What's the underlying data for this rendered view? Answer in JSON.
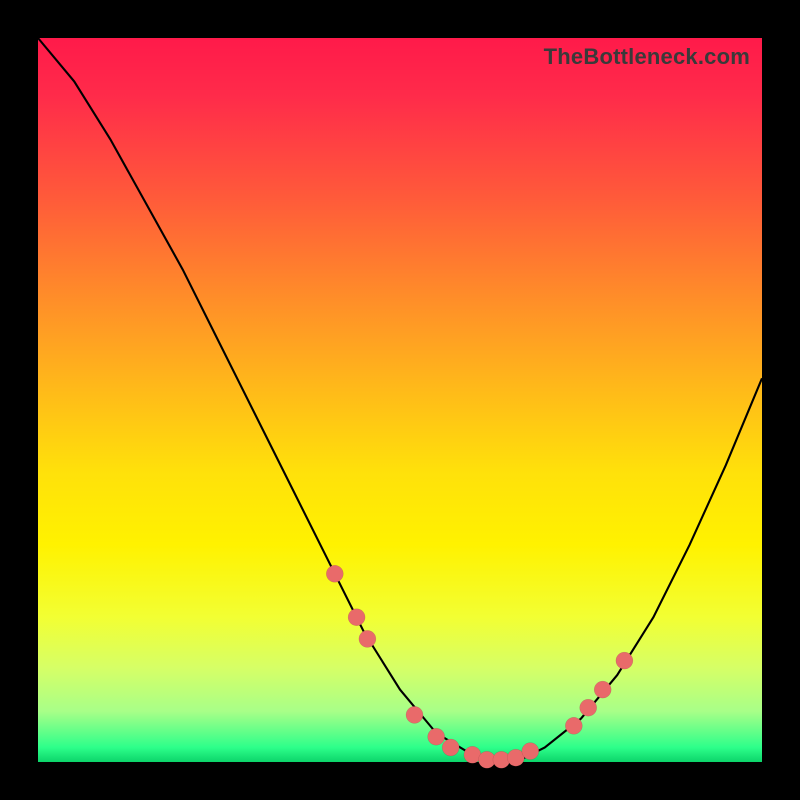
{
  "watermark": "TheBottleneck.com",
  "colors": {
    "frame": "#000000",
    "dot": "#e96a6a",
    "curve": "#000000"
  },
  "chart_data": {
    "type": "line",
    "title": "",
    "xlabel": "",
    "ylabel": "",
    "xlim": [
      0,
      100
    ],
    "ylim": [
      0,
      100
    ],
    "series": [
      {
        "name": "bottleneck-curve",
        "x": [
          0,
          5,
          10,
          15,
          20,
          25,
          30,
          35,
          40,
          45,
          50,
          55,
          60,
          62,
          64,
          67,
          70,
          75,
          80,
          85,
          90,
          95,
          100
        ],
        "y": [
          100,
          94,
          86,
          77,
          68,
          58,
          48,
          38,
          28,
          18,
          10,
          4,
          1,
          0,
          0,
          0.5,
          2,
          6,
          12,
          20,
          30,
          41,
          53
        ]
      }
    ],
    "markers": {
      "name": "highlighted-range-dots",
      "x": [
        41,
        44,
        45.5,
        52,
        55,
        57,
        60,
        62,
        64,
        66,
        68,
        74,
        76,
        78,
        81
      ],
      "y": [
        26,
        20,
        17,
        6.5,
        3.5,
        2,
        1,
        0.3,
        0.3,
        0.6,
        1.5,
        5,
        7.5,
        10,
        14
      ]
    },
    "gradient_stops": [
      {
        "pos": 0,
        "color": "#ff1a4a"
      },
      {
        "pos": 35,
        "color": "#ff8a2a"
      },
      {
        "pos": 70,
        "color": "#fff200"
      },
      {
        "pos": 100,
        "color": "#0cd46a"
      }
    ]
  }
}
